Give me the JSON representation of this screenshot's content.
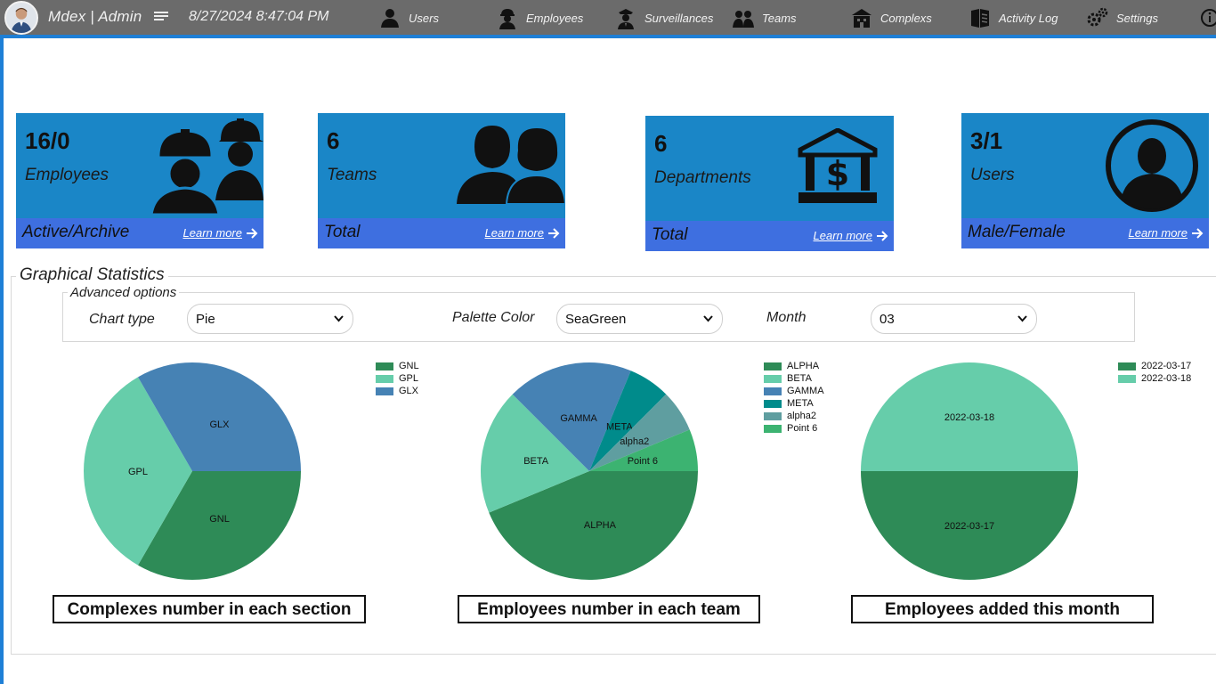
{
  "header": {
    "brand": "Mdex | Admin",
    "datetime": "8/27/2024 8:47:04 PM",
    "nav": [
      {
        "label": "Users",
        "icon": "user-icon"
      },
      {
        "label": "Employees",
        "icon": "worker-icon"
      },
      {
        "label": "Surveillances",
        "icon": "guard-icon"
      },
      {
        "label": "Teams",
        "icon": "team-icon"
      },
      {
        "label": "Complexs",
        "icon": "building-icon"
      },
      {
        "label": "Activity Log",
        "icon": "activity-log-icon"
      },
      {
        "label": "Settings",
        "icon": "gears-icon"
      }
    ]
  },
  "cards": [
    {
      "value": "16/0",
      "label": "Employees",
      "footer": "Active/Archive",
      "link": "Learn more",
      "icon": "workers-helmet-icon"
    },
    {
      "value": "6",
      "label": "Teams",
      "footer": "Total",
      "link": "Learn more",
      "icon": "people-pair-icon"
    },
    {
      "value": "6",
      "label": "Departments",
      "footer": "Total",
      "link": "Learn more",
      "icon": "bank-dollar-icon"
    },
    {
      "value": "3/1",
      "label": "Users",
      "footer": "Male/Female",
      "link": "Learn more",
      "icon": "user-circle-icon"
    }
  ],
  "stats": {
    "title": "Graphical Statistics",
    "advanced_title": "Advanced options",
    "chart_type_label": "Chart type",
    "chart_type_value": "Pie",
    "palette_label": "Palette Color",
    "palette_value": "SeaGreen",
    "month_label": "Month",
    "month_value": "03"
  },
  "colors": {
    "card_bg": "#1a86c7",
    "card_footer": "#3e6fe0",
    "topbar": "#6b6b6b",
    "accent": "#1e7fd6"
  },
  "chart_data": [
    {
      "type": "pie",
      "title": "Complexes number in each section",
      "categories": [
        "GNL",
        "GPL",
        "GLX"
      ],
      "values": [
        1,
        1,
        1
      ],
      "colors": [
        "#2e8b57",
        "#66cdaa",
        "#4682b4"
      ],
      "legend": "top-right"
    },
    {
      "type": "pie",
      "title": "Employees number in each team",
      "categories": [
        "ALPHA",
        "BETA",
        "GAMMA",
        "META",
        "alpha2",
        "Point 6"
      ],
      "values": [
        7,
        3,
        3,
        1,
        1,
        1
      ],
      "colors": [
        "#2e8b57",
        "#66cdaa",
        "#4682b4",
        "#008b8b",
        "#5f9ea0",
        "#3cb371"
      ],
      "legend": "top-right"
    },
    {
      "type": "pie",
      "title": "Employees added this month",
      "categories": [
        "2022-03-17",
        "2022-03-18"
      ],
      "values": [
        1,
        1
      ],
      "colors": [
        "#2e8b57",
        "#66cdaa"
      ],
      "legend": "top-right"
    }
  ]
}
